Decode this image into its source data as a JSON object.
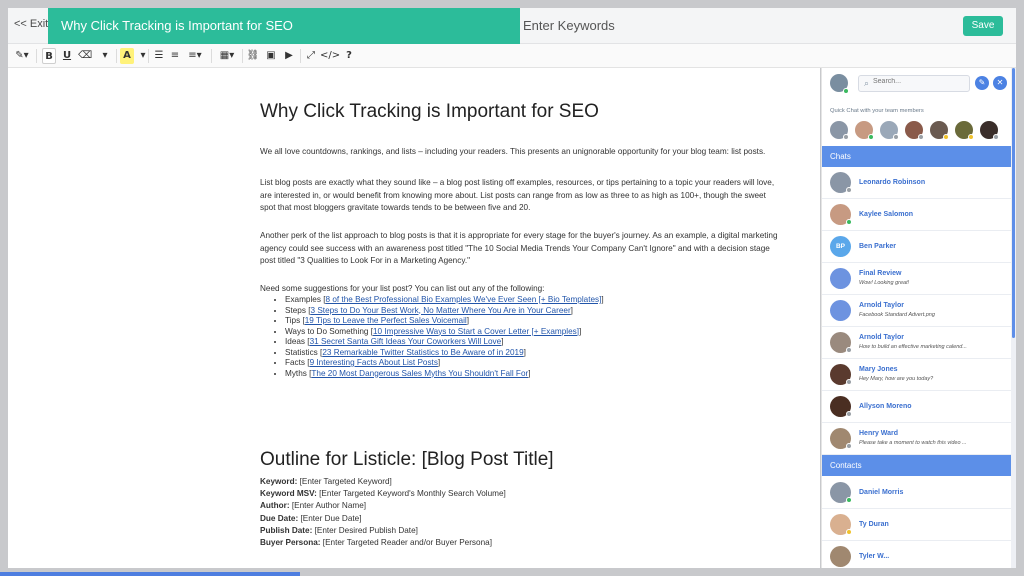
{
  "header": {
    "exit_label": "<< Exit",
    "title": "Why Click Tracking is Important for SEO",
    "keywords_label": "Enter Keywords",
    "save_label": "Save"
  },
  "toolbar": {
    "items": [
      "magic",
      "B",
      "U",
      "eraser",
      "font-size",
      "A",
      "ul",
      "ol",
      "align",
      "table",
      "link",
      "image",
      "video",
      "fullscreen",
      "code",
      "?"
    ],
    "bold": "B",
    "underline": "U",
    "color": "A",
    "help": "?",
    "code": "</>"
  },
  "document": {
    "heading": "Why Click Tracking is Important for SEO",
    "para1": "We all love countdowns, rankings, and lists – including your readers. This presents an unignorable opportunity for your blog team: list posts.",
    "para2": "List blog posts are exactly what they sound like – a blog post listing off examples, resources, or tips pertaining to a topic your readers will love, are interested in, or would benefit from knowing more about. List posts can range from as low as three to as high as 100+, though the sweet spot that most bloggers gravitate towards tends to be between five and 20.",
    "para3": "Another perk of the list approach to blog posts is that it is appropriate for every stage for the buyer's journey. As an example, a digital marketing agency could see success with an awareness post titled \"The 10 Social Media Trends Your Company Can't Ignore\" and with a decision stage post titled \"3 Qualities to Look For in a Marketing Agency.\"",
    "para4": "Need some suggestions for your list post? You can list out any of the following:",
    "list": [
      {
        "prefix": "Examples [",
        "link": "8 of the Best Professional Bio Examples We've Ever Seen [+ Bio Templates]",
        "suffix": "]"
      },
      {
        "prefix": "Steps [",
        "link": "3 Steps to Do Your Best Work, No Matter Where You Are in Your Career",
        "suffix": "]"
      },
      {
        "prefix": "Tips [",
        "link": "19 Tips to Leave the Perfect Sales Voicemail",
        "suffix": "]"
      },
      {
        "prefix": "Ways to Do Something [",
        "link": "10 Impressive Ways to Start a Cover Letter [+ Examples]",
        "suffix": "]"
      },
      {
        "prefix": "Ideas [",
        "link": "31 Secret Santa Gift Ideas Your Coworkers Will Love",
        "suffix": "]"
      },
      {
        "prefix": "Statistics [",
        "link": "23 Remarkable Twitter Statistics to Be Aware of in 2019",
        "suffix": "]"
      },
      {
        "prefix": "Facts [",
        "link": "9 Interesting Facts About List Posts",
        "suffix": "]"
      },
      {
        "prefix": "Myths [",
        "link": "The 20 Most Dangerous Sales Myths You Shouldn't Fall For",
        "suffix": "]"
      }
    ],
    "outline_heading": "Outline for Listicle: [Blog Post Title]",
    "fields": [
      {
        "label": "Keyword:",
        "value": " [Enter Targeted Keyword]"
      },
      {
        "label": "Keyword MSV:",
        "value": " [Enter Targeted Keyword's Monthly Search Volume]"
      },
      {
        "label": "Author:",
        "value": " [Enter Author Name]"
      },
      {
        "label": "Due Date:",
        "value": " [Enter Due Date]"
      },
      {
        "label": "Publish Date:",
        "value": " [Enter Desired Publish Date]"
      },
      {
        "label": "Buyer Persona:",
        "value": " [Enter Targeted Reader and/or Buyer Persona]"
      }
    ]
  },
  "chat": {
    "search_placeholder": "Search...",
    "quick_label": "Quick Chat with your team members",
    "chats_heading": "Chats",
    "contacts_heading": "Contacts",
    "chats": [
      {
        "name": "Leonardo Robinson",
        "message": "",
        "color": "#8a96a6",
        "initials": "",
        "status": "grey"
      },
      {
        "name": "Kaylee Salomon",
        "message": "",
        "color": "#c79a82",
        "initials": "",
        "status": "green"
      },
      {
        "name": "Ben Parker",
        "message": "",
        "color": "#5aa7ea",
        "initials": "BP",
        "status": ""
      },
      {
        "name": "Final Review",
        "message": "Wow! Looking great!",
        "color": "#6d93e0",
        "initials": "",
        "status": ""
      },
      {
        "name": "Arnold Taylor",
        "message": "Facebook Standard Advert.png",
        "color": "#6d93e0",
        "initials": "",
        "status": ""
      },
      {
        "name": "Arnold Taylor",
        "message": "How to build an effective marketing calend...",
        "color": "#9a8a7e",
        "initials": "",
        "status": "grey"
      },
      {
        "name": "Mary Jones",
        "message": "Hey Mary, how are you today?",
        "color": "#5a3a2e",
        "initials": "",
        "status": "grey"
      },
      {
        "name": "Allyson Moreno",
        "message": "",
        "color": "#4a2e22",
        "initials": "",
        "status": "grey"
      },
      {
        "name": "Henry Ward",
        "message": "Please take a moment to watch this video ...",
        "color": "#a08870",
        "initials": "",
        "status": "grey"
      }
    ],
    "contacts": [
      {
        "name": "Daniel Morris",
        "message": "",
        "color": "#8a96a6",
        "initials": "",
        "status": "green"
      },
      {
        "name": "Ty Duran",
        "message": "",
        "color": "#d9b090",
        "initials": "",
        "status": "yellow"
      },
      {
        "name": "Tyler W...",
        "message": "",
        "color": "#a08870",
        "initials": "",
        "status": ""
      }
    ],
    "team": [
      {
        "color": "#8a96a6",
        "status": "grey"
      },
      {
        "color": "#c79a82",
        "status": "green"
      },
      {
        "color": "#9aa8b8",
        "status": "grey"
      },
      {
        "color": "#8a5a4a",
        "status": "grey"
      },
      {
        "color": "#6a5a50",
        "status": "yellow"
      },
      {
        "color": "#6a6a3a",
        "status": "yellow"
      },
      {
        "color": "#3a2e2a",
        "status": "grey"
      }
    ]
  },
  "colors": {
    "accent": "#2cbc9a",
    "chat_blue": "#5c8fe8",
    "link": "#2255aa"
  }
}
